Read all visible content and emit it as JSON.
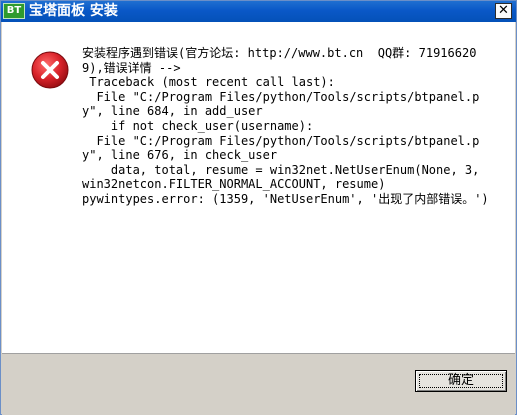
{
  "window": {
    "title": "宝塔面板 安装",
    "app_icon_text": "BT",
    "close_glyph": "✕"
  },
  "dialog": {
    "icon": "error-icon",
    "message": "安装程序遇到错误(官方论坛: http://www.bt.cn  QQ群: 719166209),错误详情 -->\n Traceback (most recent call last):\n  File \"C:/Program Files/python/Tools/scripts/btpanel.py\", line 684, in add_user\n    if not check_user(username):\n  File \"C:/Program Files/python/Tools/scripts/btpanel.py\", line 676, in check_user\n    data, total, resume = win32net.NetUserEnum(None, 3, win32netcon.FILTER_NORMAL_ACCOUNT, resume)\npywintypes.error: (1359, 'NetUserEnum', '出现了内部错误。')",
    "ok_label": "确定"
  },
  "colors": {
    "titlebar": "#0a58c7",
    "title_text": "#ffffff",
    "error_red": "#d9232a",
    "content_bg": "#ffffff",
    "footer_bg": "#d4d0c8"
  }
}
